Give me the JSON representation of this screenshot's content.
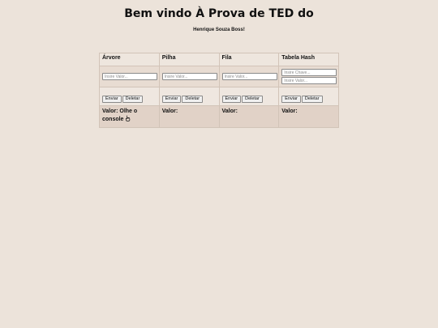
{
  "page": {
    "title": "Bem vindo À Prova de TED do",
    "subtitle": "Henrique Souza Boss!"
  },
  "columns": [
    {
      "header": "Árvore",
      "input_placeholder": "Insire Valor...",
      "send_label": "Enviar",
      "delete_label": "Deletar",
      "value_text": "Valor: Olhe o console"
    },
    {
      "header": "Pilha",
      "input_placeholder": "Insire Valor...",
      "send_label": "Enviar",
      "delete_label": "Deletar",
      "value_text": "Valor:"
    },
    {
      "header": "Fila",
      "input_placeholder": "Insire Valor...",
      "send_label": "Enviar",
      "delete_label": "Deletar",
      "value_text": "Valor:"
    },
    {
      "header": "Tabela Hash",
      "key_placeholder": "Insire Chave...",
      "input_placeholder": "Insire Valor...",
      "send_label": "Enviar",
      "delete_label": "Deletar",
      "value_text": "Valor:"
    }
  ],
  "icons": {
    "pointer": "pointing-hand-icon"
  },
  "colors": {
    "background": "#ece3da",
    "value_row": "#e1d2c7",
    "input_row": "#e8dcd2"
  }
}
